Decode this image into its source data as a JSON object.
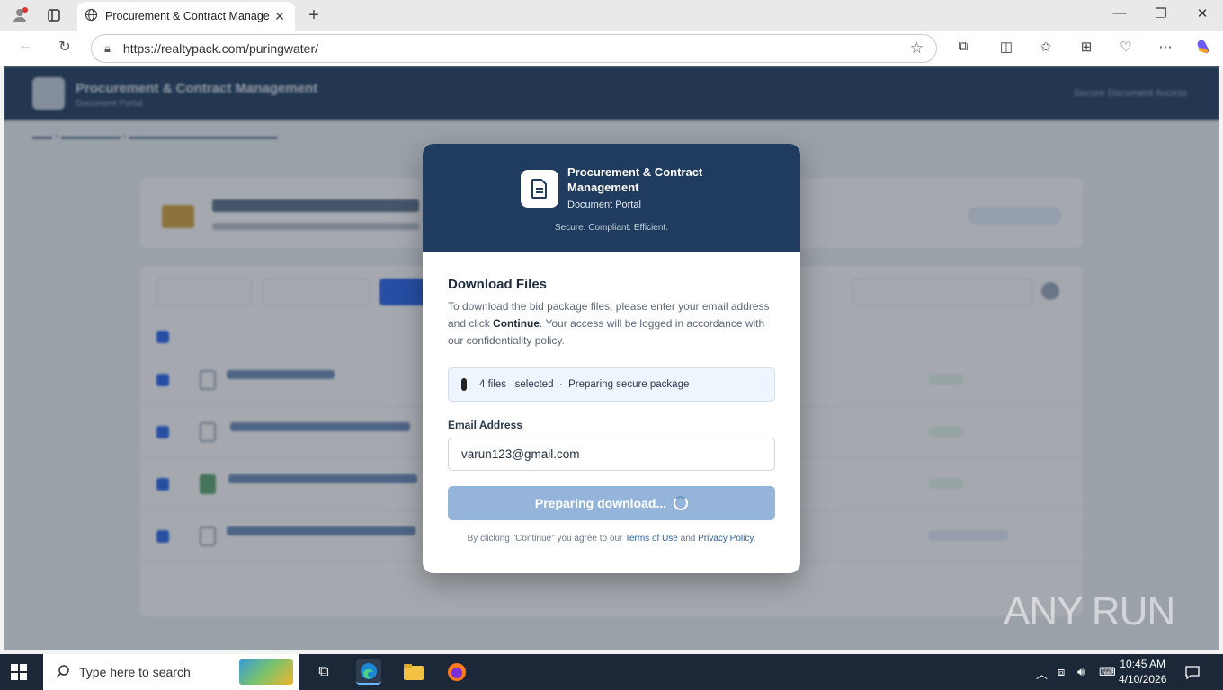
{
  "browser": {
    "tab_title": "Procurement & Contract Manage",
    "url": "https://realtypack.com/puringwater/"
  },
  "site": {
    "header_title": "Procurement & Contract Management",
    "header_subtitle": "Document Portal",
    "header_right": "Secure Document Access"
  },
  "modal": {
    "title": "Procurement & Contract Management",
    "subtitle": "Document Portal",
    "tagline": "Secure. Compliant. Efficient.",
    "section_title": "Download Files",
    "desc_pre": "To download the bid package files, please enter your email address and click ",
    "desc_bold": "Continue",
    "desc_post": ". Your access will be logged in accordance with our confidentiality policy.",
    "status_count": "4 files",
    "status_selected": "selected",
    "status_sep": "·",
    "status_text": "Preparing secure package",
    "email_label": "Email Address",
    "email_value": "varun123@gmail.com",
    "button_label": "Preparing download...",
    "terms_pre": "By clicking \"Continue\" you agree to our ",
    "terms_link1": "Terms of Use",
    "terms_and": " and ",
    "terms_link2": "Privacy Policy."
  },
  "watermark": "ANY RUN",
  "taskbar": {
    "search_placeholder": "Type here to search",
    "time": "10:45 AM",
    "date": "4/10/2026"
  }
}
